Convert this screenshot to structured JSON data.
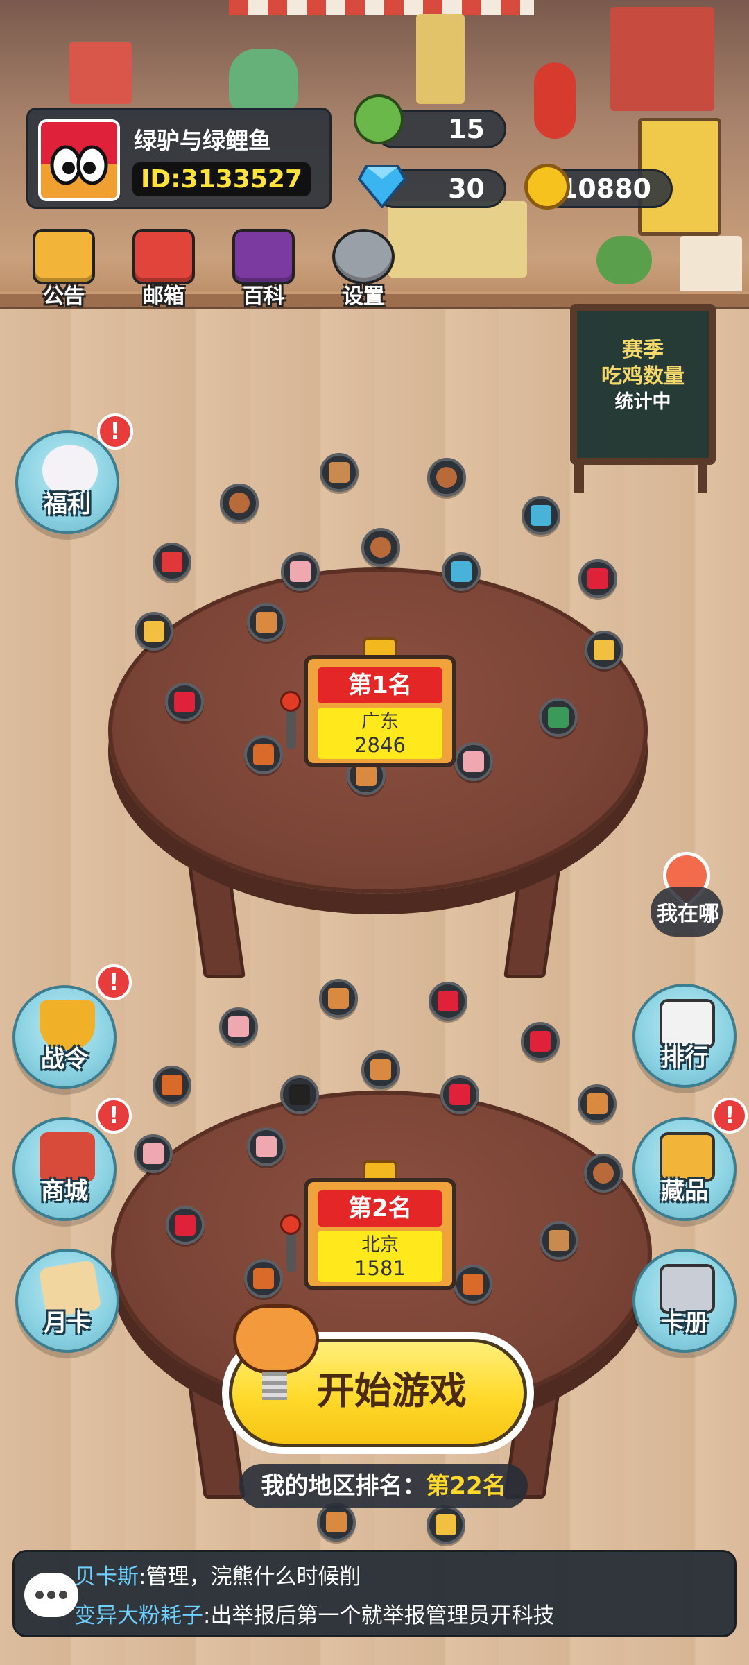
{
  "profile": {
    "nickname": "绿驴与绿鲤鱼",
    "id": "ID:3133527"
  },
  "currencies": {
    "energy": "15",
    "diamond": "30",
    "coin": "10880"
  },
  "top_menu": {
    "announce": "公告",
    "mailbox": "邮箱",
    "wiki": "百科",
    "settings": "设置"
  },
  "chalkboard": {
    "line1": "赛季",
    "line2": "吃鸡数量",
    "line3": "统计中"
  },
  "side_left": {
    "welfare": "福利",
    "battle_pass": "战令",
    "shop": "商城",
    "month_card": "月卡"
  },
  "side_right": {
    "where_am_i": "我在哪",
    "ranking": "排行",
    "collection": "藏品",
    "card_album": "卡册"
  },
  "badge_mark": "!",
  "rank_cards": [
    {
      "title": "第1名",
      "region": "广东",
      "count": "2846"
    },
    {
      "title": "第2名",
      "region": "北京",
      "count": "1581"
    }
  ],
  "start_button": "开始游戏",
  "my_rank": {
    "label": "我的地区排名：",
    "value": "第22名"
  },
  "chat": [
    {
      "user": "贝卡斯",
      "message": ":管理，浣熊什么时候削"
    },
    {
      "user": "变异大粉耗子",
      "message": ":出举报后第一个就举报管理员开科技"
    }
  ],
  "colors": {
    "accent_yellow": "#ffd92b",
    "badge_red": "#e83b3b",
    "chat_name": "#6ed0ff",
    "id_yellow": "#ffe33a"
  }
}
